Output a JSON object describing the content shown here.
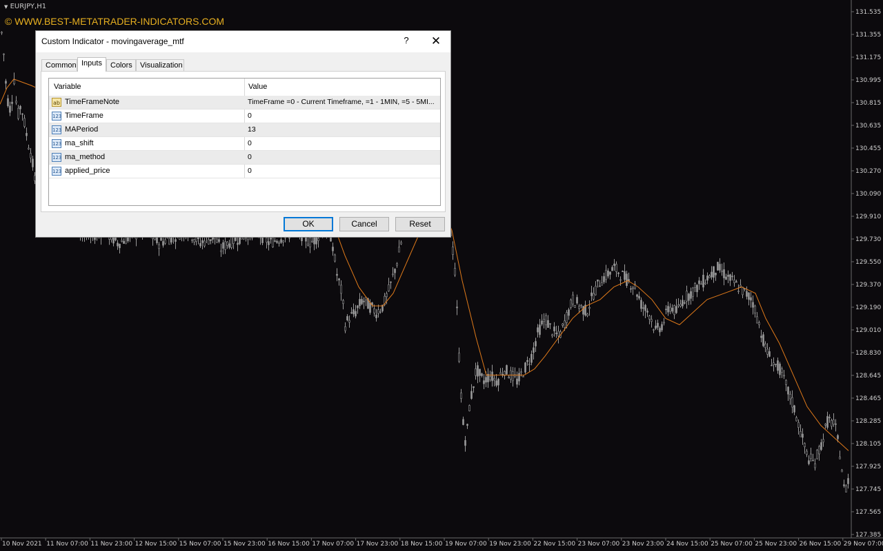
{
  "chart": {
    "symbol": "EURJPY,H1",
    "watermark": "© WWW.BEST-METATRADER-INDICATORS.COM",
    "ma_color": "#e07a1a",
    "candle_color": "#9a9a9a"
  },
  "chart_data": {
    "type": "candlestick",
    "ylim": [
      127.385,
      131.535
    ],
    "yticks": [
      "131.535",
      "131.355",
      "131.175",
      "130.995",
      "130.815",
      "130.635",
      "130.455",
      "130.270",
      "130.090",
      "129.910",
      "129.730",
      "129.550",
      "129.370",
      "129.190",
      "129.010",
      "128.830",
      "128.645",
      "128.465",
      "128.285",
      "128.105",
      "127.925",
      "127.745",
      "127.565",
      "127.385"
    ],
    "xticks": [
      "10 Nov 2021",
      "11 Nov 07:00",
      "11 Nov 23:00",
      "12 Nov 15:00",
      "15 Nov 07:00",
      "15 Nov 23:00",
      "16 Nov 15:00",
      "17 Nov 07:00",
      "17 Nov 23:00",
      "18 Nov 15:00",
      "19 Nov 07:00",
      "19 Nov 23:00",
      "22 Nov 15:00",
      "23 Nov 07:00",
      "23 Nov 23:00",
      "24 Nov 15:00",
      "25 Nov 07:00",
      "25 Nov 23:00",
      "26 Nov 15:00",
      "29 Nov 07:00"
    ],
    "price_path": [
      [
        0,
        131.3
      ],
      [
        3,
        131.4
      ],
      [
        6,
        131.1
      ],
      [
        10,
        130.85
      ],
      [
        15,
        130.75
      ],
      [
        20,
        131.0
      ],
      [
        25,
        130.7
      ],
      [
        30,
        130.8
      ],
      [
        35,
        130.65
      ],
      [
        40,
        130.5
      ],
      [
        45,
        130.4
      ],
      [
        50,
        130.2
      ],
      [
        60,
        130.0
      ],
      [
        75,
        129.9
      ],
      [
        90,
        129.85
      ],
      [
        110,
        129.8
      ],
      [
        130,
        129.75
      ],
      [
        150,
        129.8
      ],
      [
        170,
        129.7
      ],
      [
        190,
        129.75
      ],
      [
        210,
        129.8
      ],
      [
        230,
        129.7
      ],
      [
        250,
        129.75
      ],
      [
        270,
        129.8
      ],
      [
        290,
        129.7
      ],
      [
        310,
        129.75
      ],
      [
        320,
        129.65
      ],
      [
        330,
        129.7
      ],
      [
        350,
        129.75
      ],
      [
        370,
        129.8
      ],
      [
        390,
        129.7
      ],
      [
        410,
        129.75
      ],
      [
        430,
        129.8
      ],
      [
        450,
        129.7
      ],
      [
        470,
        129.8
      ],
      [
        480,
        129.75
      ],
      [
        488,
        129.45
      ],
      [
        495,
        129.3
      ],
      [
        500,
        129.05
      ],
      [
        505,
        129.1
      ],
      [
        515,
        129.15
      ],
      [
        525,
        129.25
      ],
      [
        535,
        129.2
      ],
      [
        545,
        129.15
      ],
      [
        555,
        129.2
      ],
      [
        565,
        129.35
      ],
      [
        575,
        129.55
      ],
      [
        585,
        129.8
      ],
      [
        595,
        129.9
      ],
      [
        605,
        129.95
      ],
      [
        615,
        130.05
      ],
      [
        625,
        130.1
      ],
      [
        640,
        130.0
      ],
      [
        650,
        129.9
      ],
      [
        655,
        129.7
      ],
      [
        660,
        129.4
      ],
      [
        665,
        128.8
      ],
      [
        670,
        128.3
      ],
      [
        675,
        128.1
      ],
      [
        680,
        128.4
      ],
      [
        690,
        128.7
      ],
      [
        700,
        128.6
      ],
      [
        710,
        128.65
      ],
      [
        720,
        128.6
      ],
      [
        730,
        128.7
      ],
      [
        740,
        128.65
      ],
      [
        750,
        128.6
      ],
      [
        760,
        128.7
      ],
      [
        770,
        128.8
      ],
      [
        780,
        129.0
      ],
      [
        790,
        129.1
      ],
      [
        800,
        129.0
      ],
      [
        810,
        128.95
      ],
      [
        820,
        129.1
      ],
      [
        830,
        129.25
      ],
      [
        840,
        129.2
      ],
      [
        850,
        129.15
      ],
      [
        860,
        129.3
      ],
      [
        870,
        129.4
      ],
      [
        880,
        129.45
      ],
      [
        890,
        129.5
      ],
      [
        900,
        129.45
      ],
      [
        910,
        129.4
      ],
      [
        920,
        129.35
      ],
      [
        930,
        129.2
      ],
      [
        940,
        129.15
      ],
      [
        950,
        129.0
      ],
      [
        960,
        129.05
      ],
      [
        970,
        129.2
      ],
      [
        980,
        129.15
      ],
      [
        990,
        129.25
      ],
      [
        1000,
        129.3
      ],
      [
        1010,
        129.35
      ],
      [
        1020,
        129.4
      ],
      [
        1030,
        129.45
      ],
      [
        1040,
        129.5
      ],
      [
        1050,
        129.45
      ],
      [
        1060,
        129.4
      ],
      [
        1070,
        129.35
      ],
      [
        1080,
        129.3
      ],
      [
        1090,
        129.25
      ],
      [
        1100,
        129.05
      ],
      [
        1110,
        128.85
      ],
      [
        1120,
        128.75
      ],
      [
        1130,
        128.7
      ],
      [
        1140,
        128.55
      ],
      [
        1150,
        128.4
      ],
      [
        1160,
        128.2
      ],
      [
        1170,
        128.0
      ],
      [
        1180,
        127.95
      ],
      [
        1190,
        128.1
      ],
      [
        1200,
        128.3
      ],
      [
        1210,
        128.25
      ],
      [
        1218,
        128.0
      ],
      [
        1224,
        127.7
      ],
      [
        1230,
        127.85
      ]
    ],
    "ma_path": [
      [
        0,
        130.8
      ],
      [
        10,
        130.93
      ],
      [
        20,
        131.0
      ],
      [
        30,
        130.98
      ],
      [
        45,
        130.95
      ],
      [
        480,
        129.9
      ],
      [
        500,
        129.6
      ],
      [
        520,
        129.35
      ],
      [
        540,
        129.2
      ],
      [
        555,
        129.2
      ],
      [
        570,
        129.3
      ],
      [
        590,
        129.55
      ],
      [
        610,
        129.8
      ],
      [
        625,
        129.95
      ],
      [
        640,
        130.0
      ],
      [
        655,
        129.8
      ],
      [
        670,
        129.4
      ],
      [
        690,
        128.95
      ],
      [
        705,
        128.65
      ],
      [
        720,
        128.65
      ],
      [
        740,
        128.65
      ],
      [
        760,
        128.65
      ],
      [
        775,
        128.7
      ],
      [
        790,
        128.8
      ],
      [
        810,
        128.95
      ],
      [
        830,
        129.1
      ],
      [
        850,
        129.2
      ],
      [
        870,
        129.25
      ],
      [
        890,
        129.35
      ],
      [
        910,
        129.4
      ],
      [
        925,
        129.35
      ],
      [
        945,
        129.25
      ],
      [
        965,
        129.1
      ],
      [
        985,
        129.05
      ],
      [
        1005,
        129.15
      ],
      [
        1025,
        129.25
      ],
      [
        1050,
        129.3
      ],
      [
        1075,
        129.35
      ],
      [
        1095,
        129.3
      ],
      [
        1110,
        129.1
      ],
      [
        1130,
        128.9
      ],
      [
        1150,
        128.65
      ],
      [
        1170,
        128.4
      ],
      [
        1190,
        128.25
      ],
      [
        1210,
        128.15
      ],
      [
        1230,
        128.05
      ]
    ]
  },
  "dialog": {
    "title": "Custom Indicator - movingaverage_mtf",
    "help": "?",
    "tabs": [
      "Common",
      "Inputs",
      "Colors",
      "Visualization"
    ],
    "active_tab": "Inputs",
    "columns": {
      "variable": "Variable",
      "value": "Value"
    },
    "rows": [
      {
        "icon": "ab",
        "name": "TimeFrameNote",
        "value": "TimeFrame =0 - Current Timeframe, =1 - 1MIN, =5 - 5MI..."
      },
      {
        "icon": "123",
        "name": "TimeFrame",
        "value": "0"
      },
      {
        "icon": "123",
        "name": "MAPeriod",
        "value": "13"
      },
      {
        "icon": "123",
        "name": "ma_shift",
        "value": "0"
      },
      {
        "icon": "123",
        "name": "ma_method",
        "value": "0"
      },
      {
        "icon": "123",
        "name": "applied_price",
        "value": "0"
      }
    ],
    "buttons": {
      "ok": "OK",
      "cancel": "Cancel",
      "reset": "Reset"
    },
    "accent": "#0078d7"
  }
}
